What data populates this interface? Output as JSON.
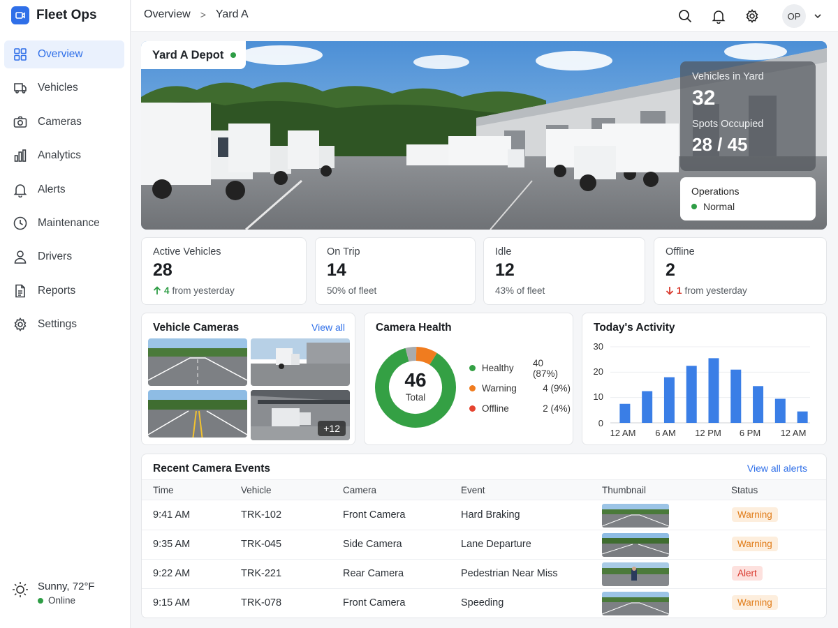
{
  "app": {
    "name": "Fleet Ops"
  },
  "sidebar": {
    "items": [
      {
        "label": "Overview",
        "icon": "grid-icon",
        "active": true
      },
      {
        "label": "Vehicles",
        "icon": "vehicle-icon"
      },
      {
        "label": "Cameras",
        "icon": "camera-icon"
      },
      {
        "label": "Analytics",
        "icon": "bar-chart-icon"
      },
      {
        "label": "Alerts",
        "icon": "bell-icon"
      },
      {
        "label": "Maintenance",
        "icon": "clock-icon"
      },
      {
        "label": "Drivers",
        "icon": "user-icon"
      },
      {
        "label": "Reports",
        "icon": "document-icon"
      },
      {
        "label": "Settings",
        "icon": "gear-icon"
      }
    ],
    "weather": {
      "text": "Sunny, 72°F",
      "status": "Online"
    }
  },
  "header": {
    "breadcrumb": [
      "Overview",
      "Yard A"
    ],
    "separator": ">",
    "avatar_initials": "OP"
  },
  "hero": {
    "title": "Yard A Depot",
    "vehicles_label": "Vehicles in Yard",
    "vehicles_value": "32",
    "spots_label": "Spots Occupied",
    "spots_value": "28 / 45",
    "ops_label": "Operations",
    "ops_status": "Normal"
  },
  "kpis": [
    {
      "label": "Active Vehicles",
      "value": "28",
      "delta": "4",
      "delta_text": "from yesterday",
      "trend": "up"
    },
    {
      "label": "On Trip",
      "value": "14",
      "sub": "50% of fleet"
    },
    {
      "label": "Idle",
      "value": "12",
      "sub": "43% of fleet"
    },
    {
      "label": "Offline",
      "value": "2",
      "delta": "1",
      "delta_text": "from yesterday",
      "trend": "down"
    }
  ],
  "vehicle_cameras": {
    "title": "Vehicle Cameras",
    "link": "View all",
    "more": "+12"
  },
  "camera_health": {
    "title": "Camera Health",
    "total": "46",
    "total_label": "Total",
    "legend": [
      {
        "name": "Healthy",
        "value": "40 (87%)",
        "count": 40,
        "color": "#34a044"
      },
      {
        "name": "Warning",
        "value": "4 (9%)",
        "count": 4,
        "color": "#f07c1f"
      },
      {
        "name": "Offline",
        "value": "2 (4%)",
        "count": 2,
        "color": "#a9abad"
      }
    ],
    "offline_legend_color": "#e5432f"
  },
  "activity": {
    "title": "Today's Activity",
    "y_ticks": [
      "30",
      "20",
      "10",
      "0"
    ],
    "x_ticks": [
      "12 AM",
      "6 AM",
      "12 PM",
      "6 PM",
      "12 AM"
    ]
  },
  "chart_data": {
    "type": "bar",
    "title": "Today's Activity",
    "values": [
      7.5,
      12.5,
      18,
      22.5,
      25.5,
      21,
      14.5,
      9.5,
      4.5
    ],
    "ylim": [
      0,
      30
    ],
    "color": "#3a7ee6"
  },
  "events": {
    "title": "Recent Camera Events",
    "link": "View all alerts",
    "columns": [
      "Time",
      "Vehicle",
      "Camera",
      "Event",
      "Thumbnail",
      "Status"
    ],
    "rows": [
      {
        "time": "9:41 AM",
        "vehicle": "TRK-102",
        "camera": "Front Camera",
        "event": "Hard Braking",
        "status": "Warning"
      },
      {
        "time": "9:35 AM",
        "vehicle": "TRK-045",
        "camera": "Side Camera",
        "event": "Lane Departure",
        "status": "Warning"
      },
      {
        "time": "9:22 AM",
        "vehicle": "TRK-221",
        "camera": "Rear Camera",
        "event": "Pedestrian Near Miss",
        "status": "Alert"
      },
      {
        "time": "9:15 AM",
        "vehicle": "TRK-078",
        "camera": "Front Camera",
        "event": "Speeding",
        "status": "Warning"
      }
    ]
  }
}
